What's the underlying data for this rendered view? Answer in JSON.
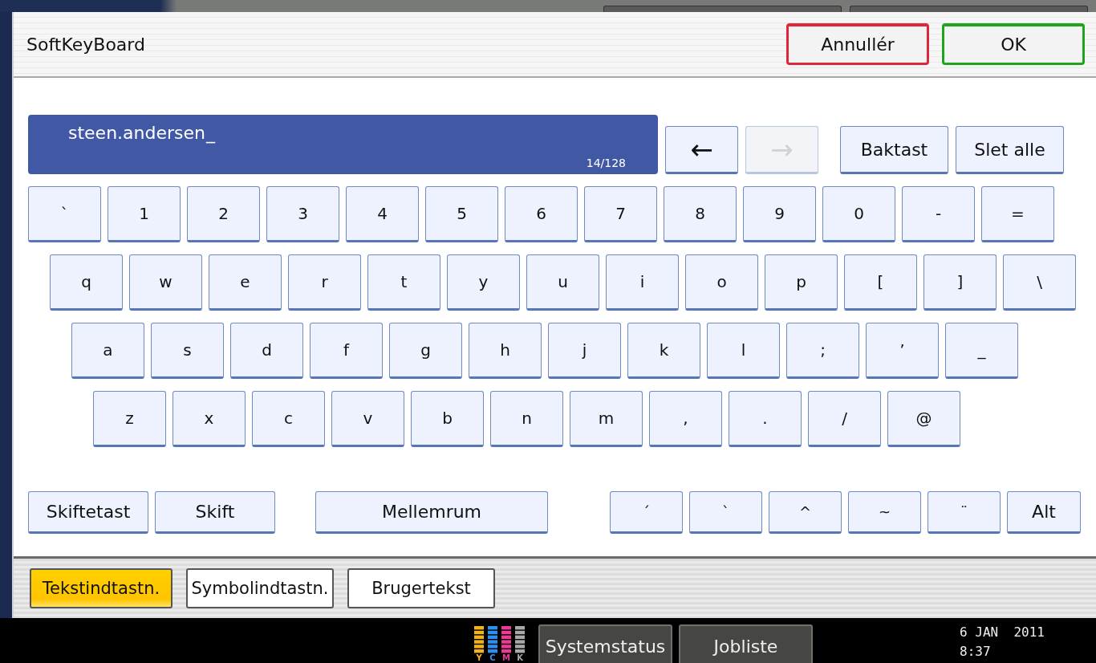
{
  "window": {
    "title": "SoftKeyBoard"
  },
  "header_buttons": [
    {
      "label": "Annullér",
      "kind": "cancel"
    },
    {
      "label": "OK",
      "kind": "ok"
    }
  ],
  "input": {
    "value": "steen.andersen",
    "cursor": "_",
    "counter": "14/128"
  },
  "cursor_buttons": [
    {
      "label": "←",
      "disabled": false
    },
    {
      "label": "→",
      "disabled": true
    }
  ],
  "edit_buttons": [
    "Baktast",
    "Slet alle"
  ],
  "key_rows": [
    [
      "`",
      "1",
      "2",
      "3",
      "4",
      "5",
      "6",
      "7",
      "8",
      "9",
      "0",
      "-",
      "="
    ],
    [
      "q",
      "w",
      "e",
      "r",
      "t",
      "y",
      "u",
      "i",
      "o",
      "p",
      "[",
      "]",
      "\\"
    ],
    [
      "a",
      "s",
      "d",
      "f",
      "g",
      "h",
      "j",
      "k",
      "l",
      ";",
      "’",
      "_"
    ],
    [
      "z",
      "x",
      "c",
      "v",
      "b",
      "n",
      "m",
      ",",
      ".",
      "/",
      "@"
    ]
  ],
  "bottom_keys": [
    {
      "label": "Skiftetast",
      "kind": "shift"
    },
    {
      "label": "Skift",
      "kind": "shift"
    },
    {
      "label": "Mellemrum",
      "kind": "space"
    },
    {
      "label": "´",
      "kind": "accent"
    },
    {
      "label": "`",
      "kind": "accent"
    },
    {
      "label": "^",
      "kind": "accent"
    },
    {
      "label": "~",
      "kind": "accent"
    },
    {
      "label": "¨",
      "kind": "accent"
    },
    {
      "label": "Alt",
      "kind": "alt"
    }
  ],
  "tabs": [
    {
      "label": "Tekstindtastn.",
      "selected": true
    },
    {
      "label": "Symbolindtastn.",
      "selected": false
    },
    {
      "label": "Brugertekst",
      "selected": false
    }
  ],
  "status_bar": {
    "ink": [
      {
        "label": "Y",
        "color": "#f2b21c"
      },
      {
        "label": "C",
        "color": "#2f8ff0"
      },
      {
        "label": "M",
        "color": "#ee3a96"
      },
      {
        "label": "K",
        "color": "#a8a8a8"
      }
    ],
    "buttons": [
      "Systemstatus",
      "Jobliste"
    ],
    "date": "6 JAN  2011",
    "time": "8:37"
  }
}
